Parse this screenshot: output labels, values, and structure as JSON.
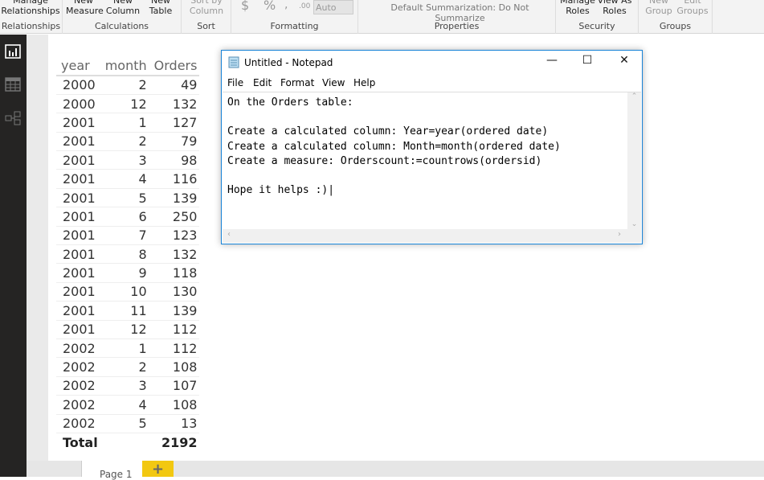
{
  "ribbon": {
    "groups": [
      {
        "label": "Relationships",
        "buttons": [
          "Manage Relationships"
        ]
      },
      {
        "label": "Calculations",
        "buttons": [
          "New Measure",
          "New Column",
          "New Table"
        ]
      },
      {
        "label": "Sort",
        "buttons": [
          "Sort by Column"
        ]
      },
      {
        "label": "Formatting",
        "buttons": [
          "$",
          "%",
          ",",
          ".00",
          "Auto"
        ]
      },
      {
        "label": "Properties",
        "buttons": [
          "Default Summarization: Do Not Summarize"
        ]
      },
      {
        "label": "Security",
        "buttons": [
          "Manage Roles",
          "View As Roles"
        ]
      },
      {
        "label": "Groups",
        "buttons": [
          "New Group",
          "Edit Groups"
        ]
      }
    ]
  },
  "table": {
    "headers": [
      "year",
      "month",
      "Orders"
    ],
    "rows": [
      [
        "2000",
        "2",
        "49"
      ],
      [
        "2000",
        "12",
        "132"
      ],
      [
        "2001",
        "1",
        "127"
      ],
      [
        "2001",
        "2",
        "79"
      ],
      [
        "2001",
        "3",
        "98"
      ],
      [
        "2001",
        "4",
        "116"
      ],
      [
        "2001",
        "5",
        "139"
      ],
      [
        "2001",
        "6",
        "250"
      ],
      [
        "2001",
        "7",
        "123"
      ],
      [
        "2001",
        "8",
        "132"
      ],
      [
        "2001",
        "9",
        "118"
      ],
      [
        "2001",
        "10",
        "130"
      ],
      [
        "2001",
        "11",
        "139"
      ],
      [
        "2001",
        "12",
        "112"
      ],
      [
        "2002",
        "1",
        "112"
      ],
      [
        "2002",
        "2",
        "108"
      ],
      [
        "2002",
        "3",
        "107"
      ],
      [
        "2002",
        "4",
        "108"
      ],
      [
        "2002",
        "5",
        "13"
      ]
    ],
    "total_label": "Total",
    "total_value": "2192"
  },
  "pages": {
    "tab": "Page 1",
    "add": "+"
  },
  "notepad": {
    "title": "Untitled - Notepad",
    "menu": [
      "File",
      "Edit",
      "Format",
      "View",
      "Help"
    ],
    "text": "On the Orders table:\n\nCreate a calculated column: Year=year(ordered date)\nCreate a calculated column: Month=month(ordered date)\nCreate a measure: Orderscount:=countrows(ordersid)\n\nHope it helps :)|"
  },
  "colors": {
    "accent": "#f2c811",
    "sidebar": "#252423",
    "window_border": "#1883d7"
  }
}
